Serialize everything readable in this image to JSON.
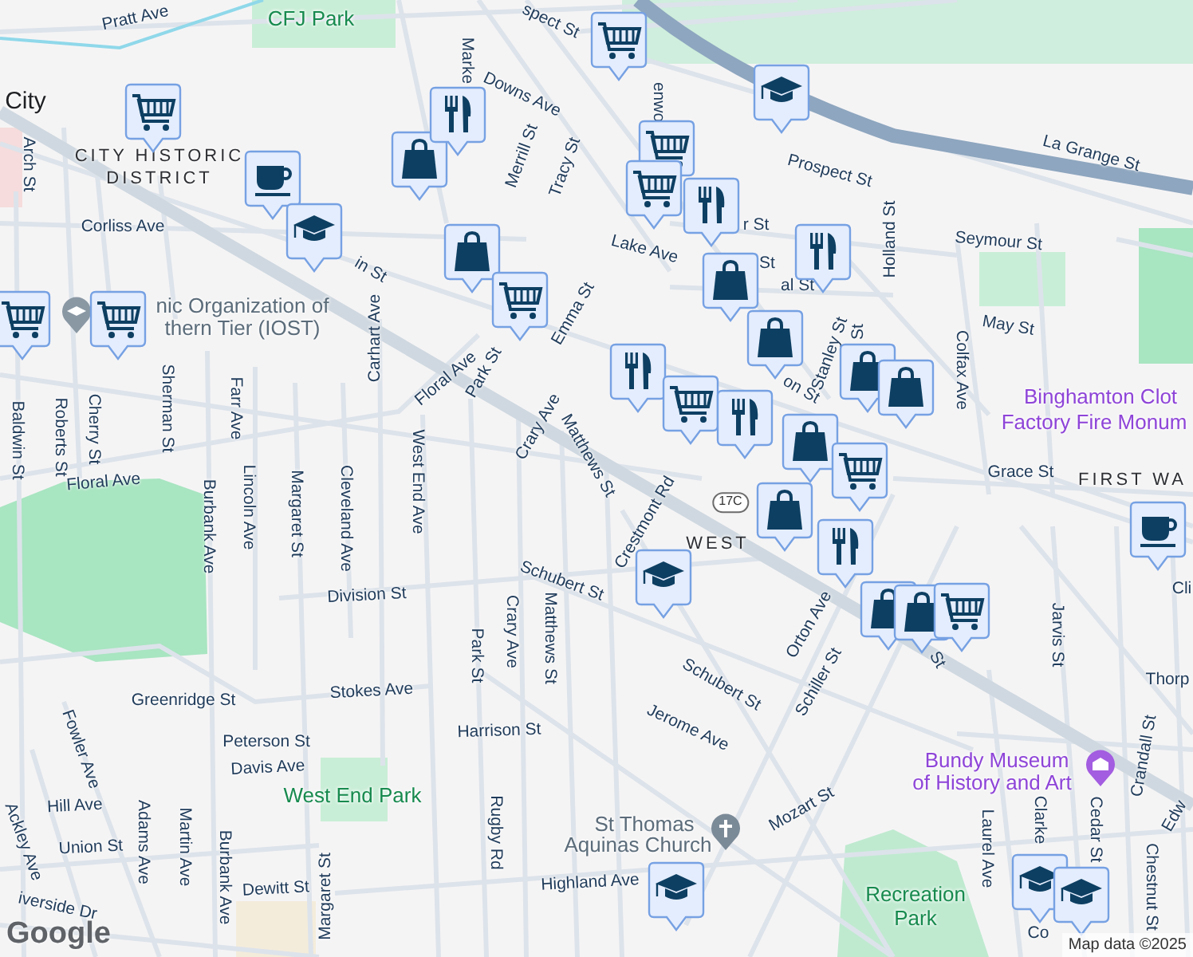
{
  "labels": [
    {
      "text": "Pratt Ave",
      "kind": "street"
    },
    {
      "text": "CFJ Park",
      "kind": "park"
    },
    {
      "text": "spect St",
      "kind": "street"
    },
    {
      "text": "Marke",
      "kind": "street"
    },
    {
      "text": "Downs Ave",
      "kind": "street"
    },
    {
      "text": "Merrill St",
      "kind": "street"
    },
    {
      "text": "Tracy St",
      "kind": "street"
    },
    {
      "text": "enwo",
      "kind": "street"
    },
    {
      "text": "Prospect St",
      "kind": "street"
    },
    {
      "text": "La Grange St",
      "kind": "street"
    },
    {
      "text": "Holland St",
      "kind": "street"
    },
    {
      "text": "Seymour St",
      "kind": "street"
    },
    {
      "text": "May St",
      "kind": "street"
    },
    {
      "text": "Colfax Ave",
      "kind": "street"
    },
    {
      "text": "Binghamton Clot",
      "kind": "poi"
    },
    {
      "text": "Factory Fire Monum",
      "kind": "poi"
    },
    {
      "text": "Grace St",
      "kind": "street"
    },
    {
      "text": "FIRST WA",
      "kind": "district"
    },
    {
      "text": "Lake Ave",
      "kind": "street"
    },
    {
      "text": "r St",
      "kind": "street"
    },
    {
      "text": "St",
      "kind": "street"
    },
    {
      "text": "al St",
      "kind": "street"
    },
    {
      "text": "on St",
      "kind": "street"
    },
    {
      "text": "Stanley St",
      "kind": "street"
    },
    {
      "text": "St",
      "kind": "street"
    },
    {
      "text": "City",
      "kind": "town"
    },
    {
      "text": "CITY HISTORIC",
      "kind": "district"
    },
    {
      "text": "DISTRICT",
      "kind": "district"
    },
    {
      "text": "Arch St",
      "kind": "street"
    },
    {
      "text": "Corliss Ave",
      "kind": "street"
    },
    {
      "text": "in St",
      "kind": "street"
    },
    {
      "text": "Carhart Ave",
      "kind": "street"
    },
    {
      "text": "Emma St",
      "kind": "street"
    },
    {
      "text": "Floral Ave",
      "kind": "street"
    },
    {
      "text": "Park St",
      "kind": "street"
    },
    {
      "text": "Crary Ave",
      "kind": "street"
    },
    {
      "text": "Matthews St",
      "kind": "street"
    },
    {
      "text": "West End Ave",
      "kind": "street"
    },
    {
      "text": "Baldwin St",
      "kind": "street"
    },
    {
      "text": "Roberts St",
      "kind": "street"
    },
    {
      "text": "Cherry St",
      "kind": "street"
    },
    {
      "text": "Sherman St",
      "kind": "street"
    },
    {
      "text": "Farr Ave",
      "kind": "street"
    },
    {
      "text": "nic Organization of",
      "kind": "place"
    },
    {
      "text": "thern Tier (IOST)",
      "kind": "place"
    },
    {
      "text": "Floral Ave",
      "kind": "street"
    },
    {
      "text": "Burbank Ave",
      "kind": "street"
    },
    {
      "text": "Lincoln Ave",
      "kind": "street"
    },
    {
      "text": "Margaret St",
      "kind": "street"
    },
    {
      "text": "Cleveland Ave",
      "kind": "street"
    },
    {
      "text": "Crestmont Rd",
      "kind": "street"
    },
    {
      "text": "17C",
      "kind": "route"
    },
    {
      "text": "WEST",
      "kind": "district"
    },
    {
      "text": "Schubert St",
      "kind": "street"
    },
    {
      "text": "Division St",
      "kind": "street"
    },
    {
      "text": "Park St",
      "kind": "street"
    },
    {
      "text": "Crary Ave",
      "kind": "street"
    },
    {
      "text": "Matthews St",
      "kind": "street"
    },
    {
      "text": "Stokes Ave",
      "kind": "street"
    },
    {
      "text": "Greenridge St",
      "kind": "street"
    },
    {
      "text": "Harrison St",
      "kind": "street"
    },
    {
      "text": "Peterson St",
      "kind": "street"
    },
    {
      "text": "Davis Ave",
      "kind": "street"
    },
    {
      "text": "West End Park",
      "kind": "park"
    },
    {
      "text": "Hill Ave",
      "kind": "street"
    },
    {
      "text": "Fowler Ave",
      "kind": "street"
    },
    {
      "text": "Union St",
      "kind": "street"
    },
    {
      "text": "Ackley Ave",
      "kind": "street"
    },
    {
      "text": "Adams Ave",
      "kind": "street"
    },
    {
      "text": "Martin Ave",
      "kind": "street"
    },
    {
      "text": "Burbank Ave",
      "kind": "street"
    },
    {
      "text": "Dewitt St",
      "kind": "street"
    },
    {
      "text": "Margaret St",
      "kind": "street"
    },
    {
      "text": "iverside Dr",
      "kind": "street"
    },
    {
      "text": "Rugby Rd",
      "kind": "street"
    },
    {
      "text": "Highland Ave",
      "kind": "street"
    },
    {
      "text": "St Thomas",
      "kind": "place"
    },
    {
      "text": "Aquinas Church",
      "kind": "place"
    },
    {
      "text": "Mozart St",
      "kind": "street"
    },
    {
      "text": "Jerome Ave",
      "kind": "street"
    },
    {
      "text": "Schubert St",
      "kind": "street"
    },
    {
      "text": "Orton Ave",
      "kind": "street"
    },
    {
      "text": "Schiller St",
      "kind": "street"
    },
    {
      "text": "St",
      "kind": "street"
    },
    {
      "text": "Bundy Museum",
      "kind": "poi"
    },
    {
      "text": "of History and Art",
      "kind": "poi"
    },
    {
      "text": "Jarvis St",
      "kind": "street"
    },
    {
      "text": "Thorp",
      "kind": "street"
    },
    {
      "text": "Crandall St",
      "kind": "street"
    },
    {
      "text": "Laurel Ave",
      "kind": "street"
    },
    {
      "text": "Clarke",
      "kind": "street"
    },
    {
      "text": "Cedar St",
      "kind": "street"
    },
    {
      "text": "Chestnut St",
      "kind": "street"
    },
    {
      "text": "Edw",
      "kind": "street"
    },
    {
      "text": "Recreation",
      "kind": "park"
    },
    {
      "text": "Park",
      "kind": "park"
    },
    {
      "text": "Co",
      "kind": "street"
    },
    {
      "text": "Cli",
      "kind": "street"
    }
  ],
  "markers": [
    {
      "kind": "shopping"
    },
    {
      "kind": "school"
    },
    {
      "kind": "shopping"
    },
    {
      "kind": "bag"
    },
    {
      "kind": "food"
    },
    {
      "kind": "coffee"
    },
    {
      "kind": "school"
    },
    {
      "kind": "shopping"
    },
    {
      "kind": "shopping"
    },
    {
      "kind": "food"
    },
    {
      "kind": "food"
    },
    {
      "kind": "bag"
    },
    {
      "kind": "bag"
    },
    {
      "kind": "bag"
    },
    {
      "kind": "shopping"
    },
    {
      "kind": "shopping"
    },
    {
      "kind": "shopping"
    },
    {
      "kind": "food"
    },
    {
      "kind": "shopping"
    },
    {
      "kind": "food"
    },
    {
      "kind": "bag"
    },
    {
      "kind": "bag"
    },
    {
      "kind": "bag"
    },
    {
      "kind": "shopping"
    },
    {
      "kind": "bag"
    },
    {
      "kind": "food"
    },
    {
      "kind": "school"
    },
    {
      "kind": "bag"
    },
    {
      "kind": "bag"
    },
    {
      "kind": "shopping"
    },
    {
      "kind": "coffee"
    },
    {
      "kind": "school"
    },
    {
      "kind": "school"
    },
    {
      "kind": "school"
    }
  ],
  "attribution": "Map data ©2025",
  "logo": "Google"
}
